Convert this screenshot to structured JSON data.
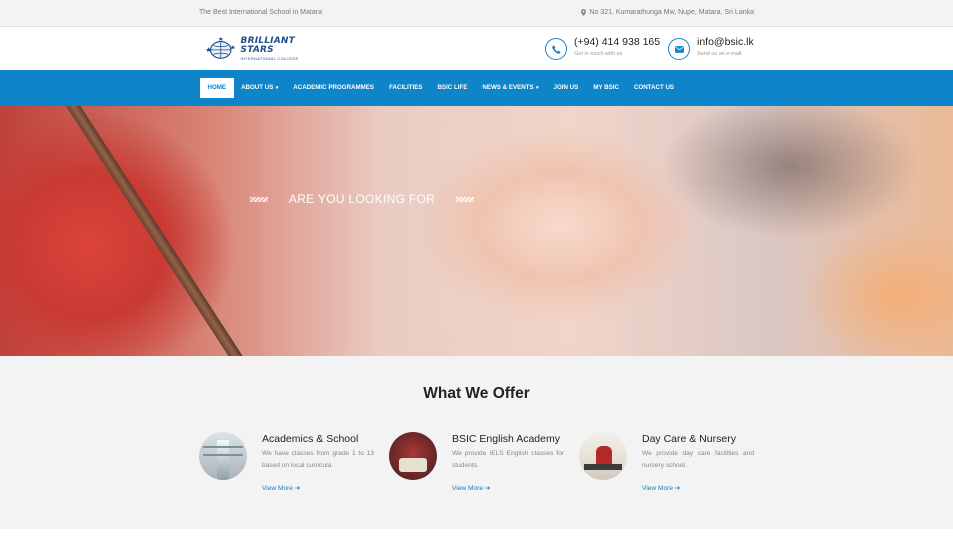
{
  "topbar": {
    "tagline": "The Best International School in Matara",
    "address": "No 321, Kumarathunga Mw, Nupe, Matara, Sri Lanka"
  },
  "header": {
    "logo_main": "BRILLIANT STARS",
    "logo_sub": "INTERNATIONAL COLLEGE",
    "phone": {
      "value": "(+94) 414 938 165",
      "sub": "Get in touch with us"
    },
    "email": {
      "value": "info@bsic.lk",
      "sub": "Send us an e-mail"
    }
  },
  "nav": {
    "items": [
      {
        "label": "Home",
        "active": true
      },
      {
        "label": "About Us",
        "dropdown": true
      },
      {
        "label": "Academic Programmes"
      },
      {
        "label": "Facilities"
      },
      {
        "label": "BSIC Life"
      },
      {
        "label": "News & Events",
        "dropdown": true
      },
      {
        "label": "Join Us"
      },
      {
        "label": "My BSIC"
      },
      {
        "label": "Contact Us"
      }
    ]
  },
  "hero": {
    "title": "ARE YOU LOOKING FOR"
  },
  "offer": {
    "title_light": "What We ",
    "title_bold": "Offer",
    "cards": [
      {
        "title": "Academics & School",
        "desc": "We have classes from grade 1 to 13 based on local curricula.",
        "more": "View More"
      },
      {
        "title": "BSIC English Academy",
        "desc": "We provide IELS English classes for students.",
        "more": "View More"
      },
      {
        "title": "Day Care & Nursery",
        "desc": "We provide day care facilities and nursery school.",
        "more": "View More"
      }
    ]
  },
  "colors": {
    "primary": "#0e84c9",
    "logo": "#1f4e8c"
  }
}
